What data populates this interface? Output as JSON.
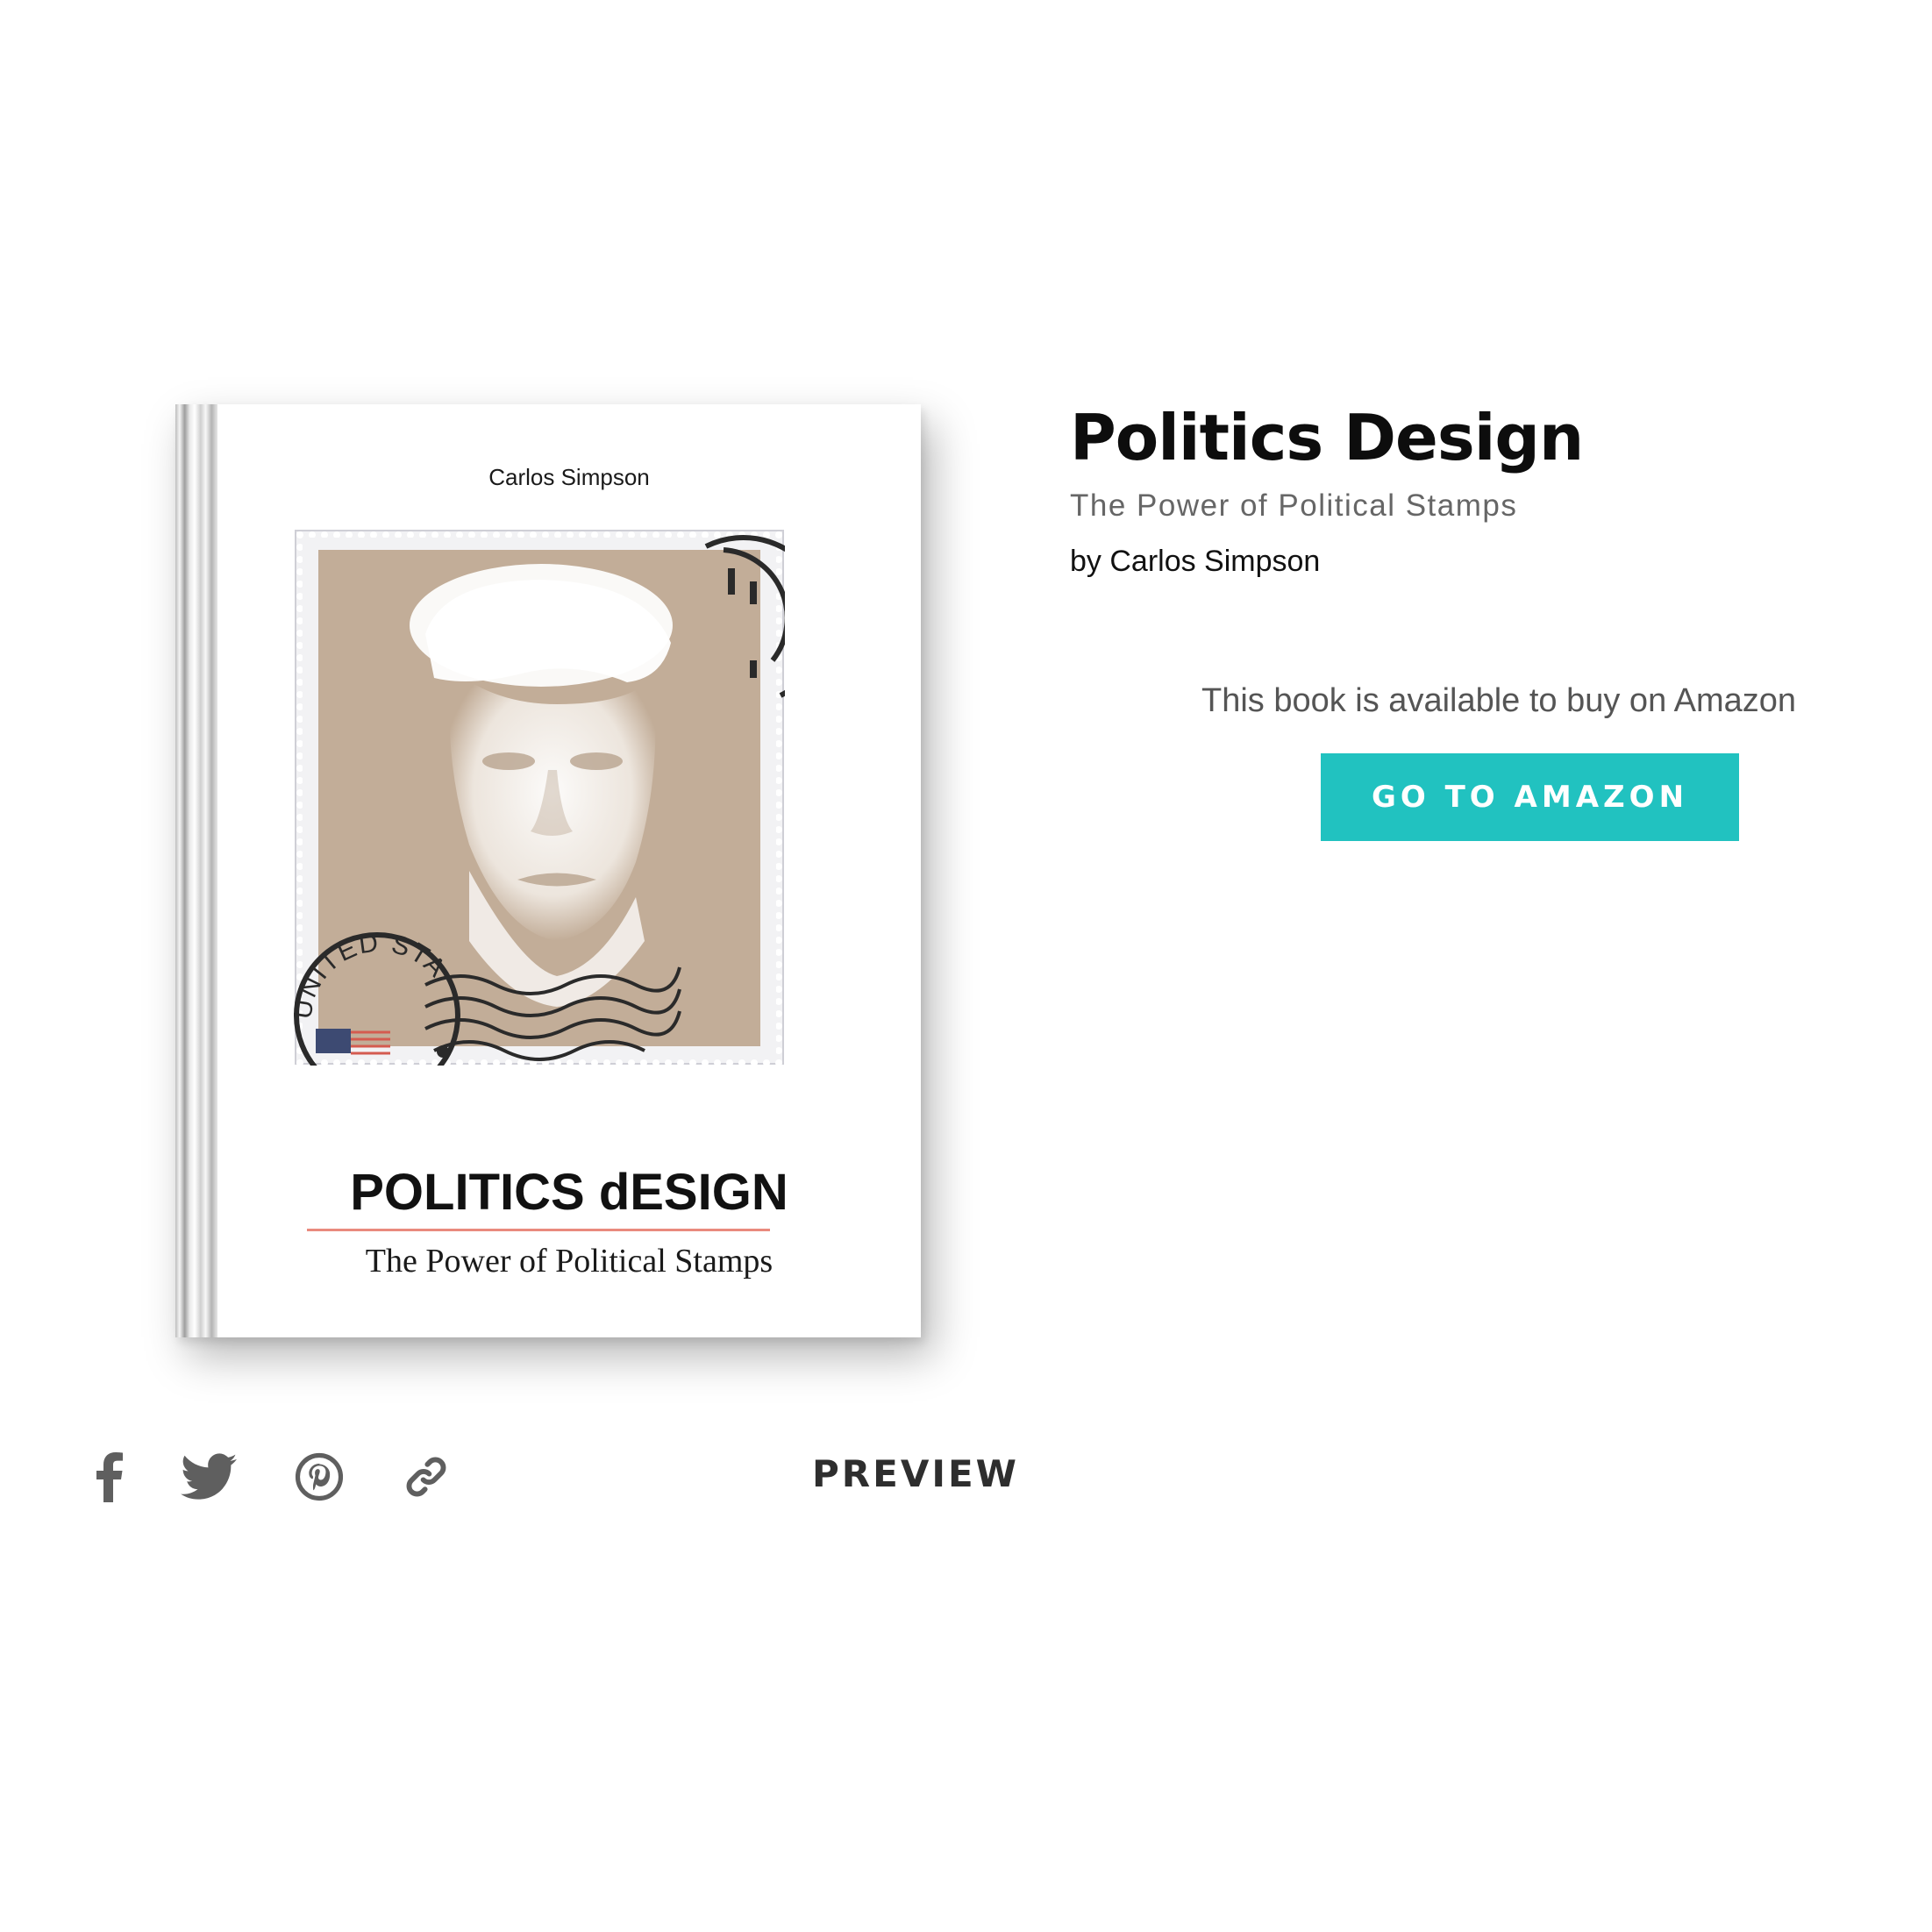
{
  "book": {
    "title": "Politics Design",
    "subtitle": "The Power of Political Stamps",
    "author_line": "by Carlos Simpson"
  },
  "cover": {
    "author": "Carlos Simpson",
    "title": "POLITICS dESIGN",
    "subtitle": "The Power of Political Stamps",
    "stamp_text": "UNITED STATES",
    "stamp_background": "#c2ad98",
    "rule_color": "#e98a7e"
  },
  "purchase": {
    "availability_text": "This book is available to buy on Amazon",
    "button_label": "GO TO AMAZON",
    "button_color": "#21c2c0"
  },
  "share": {
    "icons": [
      "facebook-icon",
      "twitter-icon",
      "pinterest-icon",
      "link-icon"
    ],
    "icon_color": "#5f5f5f"
  },
  "preview_label": "PREVIEW"
}
